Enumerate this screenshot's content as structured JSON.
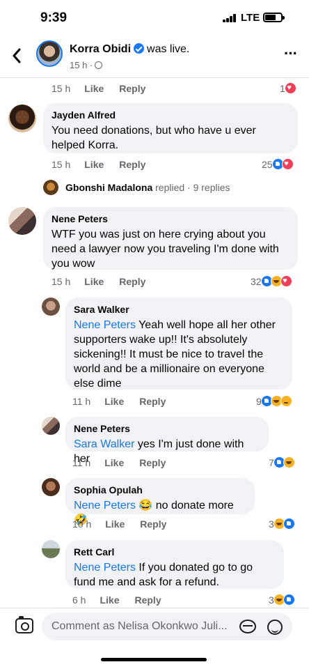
{
  "status_bar": {
    "time": "9:39",
    "network": "LTE"
  },
  "header": {
    "name": "Korra Obidi",
    "suffix": "was live.",
    "meta": "15 h ·",
    "more": "···"
  },
  "actions": {
    "like": "Like",
    "reply": "Reply"
  },
  "top_row": {
    "time": "15 h",
    "reaction_count": "1"
  },
  "comments": [
    {
      "author": "Jayden Alfred",
      "text": "You need donations, but who have u ever helped Korra.",
      "time": "15 h",
      "reaction_count": "25",
      "reactions": [
        "like",
        "love"
      ]
    },
    {
      "author": "Nene Peters",
      "text": "WTF you was just on here crying about you need a lawyer now you traveling I'm done with you wow",
      "time": "15 h",
      "reaction_count": "32",
      "reactions": [
        "like",
        "haha",
        "love"
      ]
    }
  ],
  "reply_summary": {
    "name": "Gbonshi Madalona",
    "text": "replied · 9 replies"
  },
  "replies": [
    {
      "author": "Sara Walker",
      "mention": "Nene Peters",
      "text": " Yeah well hope all her other supporters wake up!! It's absolutely sickening!! It must be nice to travel the world and be a millionaire on everyone else dime",
      "time": "11 h",
      "reaction_count": "9",
      "reactions": [
        "like",
        "haha",
        "sad"
      ]
    },
    {
      "author": "Nene Peters",
      "mention": "Sara Walker",
      "text": " yes I'm just done with her",
      "time": "11 h",
      "reaction_count": "7",
      "reactions": [
        "like",
        "haha"
      ]
    },
    {
      "author": "Sophia Opulah",
      "mention": "Nene Peters",
      "text": " 😂  no donate more 🤣",
      "time": "10 h",
      "reaction_count": "3",
      "reactions": [
        "haha",
        "like"
      ]
    },
    {
      "author": "Rett Carl",
      "mention": "Nene Peters",
      "text": " If you donated go to go fund me and ask for a refund.",
      "time": "6 h",
      "reaction_count": "3",
      "reactions": [
        "haha",
        "like"
      ]
    }
  ],
  "composer": {
    "placeholder": "Comment as Nelisa Okonkwo Juli..."
  },
  "colors": {
    "accent": "#1877f2",
    "bubble": "#f0f2f5",
    "muted": "#65676b"
  }
}
